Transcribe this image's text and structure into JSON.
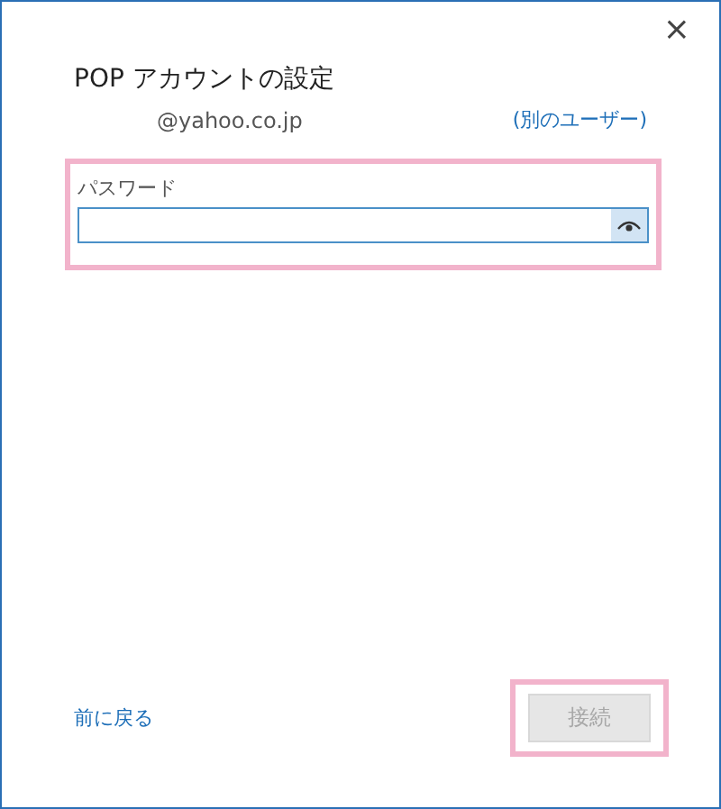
{
  "window": {
    "close": "×"
  },
  "title": "POP アカウントの設定",
  "email": "@yahoo.co.jp",
  "other_user_link": "(別のユーザー)",
  "password": {
    "label": "パスワード",
    "highlighted": true
  },
  "back_link": "前に戻る",
  "connect_button": {
    "label": "接続",
    "disabled": true,
    "highlighted": true
  }
}
